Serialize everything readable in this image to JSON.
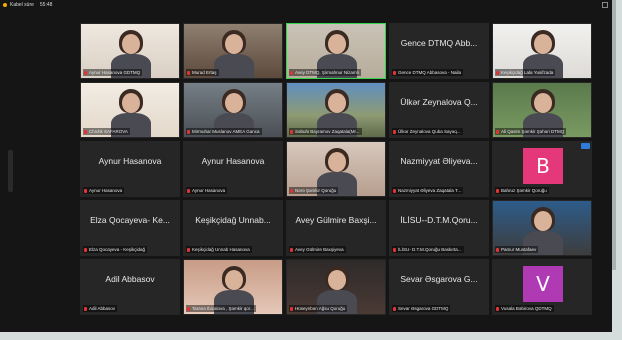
{
  "titlebar": {
    "label": "Kabel süre",
    "time": "55:48"
  },
  "tiles": [
    {
      "id": "t1",
      "caption": "Aynur Hasanova GDTMQ",
      "type": "photo",
      "bg": "ph-bg1"
    },
    {
      "id": "t2",
      "caption": "Murad Ertaş",
      "type": "photo",
      "bg": "ph-bg2"
    },
    {
      "id": "t3",
      "caption": "Avey DTMQ, Şirmahnur Nizamlı",
      "type": "photo",
      "bg": "ph-bg3",
      "speaking": true
    },
    {
      "id": "t4",
      "big": "Gence DTMQ Abb...",
      "caption": "Gence DTMQ Abbasova - Naila",
      "type": "name"
    },
    {
      "id": "t5",
      "caption": "Keşikçidağ Lala Yusifzada",
      "type": "photo",
      "bg": "ph-bg4"
    },
    {
      "id": "t6",
      "caption": "Chichk SAFAROVA",
      "type": "photo",
      "bg": "ph-bg5"
    },
    {
      "id": "t7",
      "caption": "Mirmuhar Muslanov AMEA Ganca",
      "type": "photo",
      "bg": "ph-bg6"
    },
    {
      "id": "t8",
      "caption": "Səbuhi Bayramov Zaqatala(Mr...",
      "type": "photo",
      "bg": "ph-bg7"
    },
    {
      "id": "t9",
      "big": "Ülkər Zeynalova Q...",
      "caption": "Ülkər Zeynalova Quba Sayəq...",
      "type": "name"
    },
    {
      "id": "t10",
      "caption": "Ali Qasim Şəmkir Şəhəri DTMQ",
      "type": "photo",
      "bg": "ph-bg8"
    },
    {
      "id": "t11",
      "big": "Aynur Hasanova",
      "caption": "Aynur Hasanova",
      "type": "name"
    },
    {
      "id": "t12",
      "big": "Aynur Hasanova",
      "caption": "Aynur Hasanova",
      "type": "name"
    },
    {
      "id": "t13",
      "caption": "Nərə Şəmkir Qoruğu",
      "type": "photo",
      "bg": "ph-bg9"
    },
    {
      "id": "t14",
      "big": "Nazmiyyat Əliyeva...",
      "caption": "Nazmiyyat Əliyeva Zaqatala T...",
      "type": "name"
    },
    {
      "id": "t15",
      "caption": "Bahruz Şəmkir Qoruğu",
      "type": "avatar",
      "letter": "B",
      "color": "#e4387a",
      "badge": true
    },
    {
      "id": "t16",
      "big": "Elza Qocayeva- Ke...",
      "caption": "Elza Qocayeva - Keşikçidağ",
      "type": "name"
    },
    {
      "id": "t17",
      "big": "Keşikçidağ Unnab...",
      "caption": "Keşikçidağ Unnab Hasanova",
      "type": "name"
    },
    {
      "id": "t18",
      "big": "Avey Gülmire Baxşi...",
      "caption": "Avey Gülmire Baxşiyeva",
      "type": "name"
    },
    {
      "id": "t19",
      "big": "İLİSU--D.T.M.Qoru...",
      "caption": "İLİSU- D.T.M.Qoruğu Baskırta...",
      "type": "name"
    },
    {
      "id": "t20",
      "caption": "Pamur Mustafaev",
      "type": "photo",
      "bg": "ph-bg10"
    },
    {
      "id": "t21",
      "big": "Adil Abbasov",
      "caption": "Adil Abbasov",
      "type": "name"
    },
    {
      "id": "t22",
      "caption": "Tarana Ibicalova , Şəmkir qor...",
      "type": "photo",
      "bg": "ph-bg11"
    },
    {
      "id": "t23",
      "caption": "Hüseynbən Ağsu Qoruğu",
      "type": "photo",
      "bg": "ph-bg12"
    },
    {
      "id": "t24",
      "big": "Sevar Əsgarova G...",
      "caption": "Sevar Əsgarova GDTMQ",
      "type": "name"
    },
    {
      "id": "t25",
      "caption": "Vusala Bəbirova QDTMQ",
      "type": "avatar",
      "letter": "V",
      "color": "#b03ab4"
    }
  ]
}
